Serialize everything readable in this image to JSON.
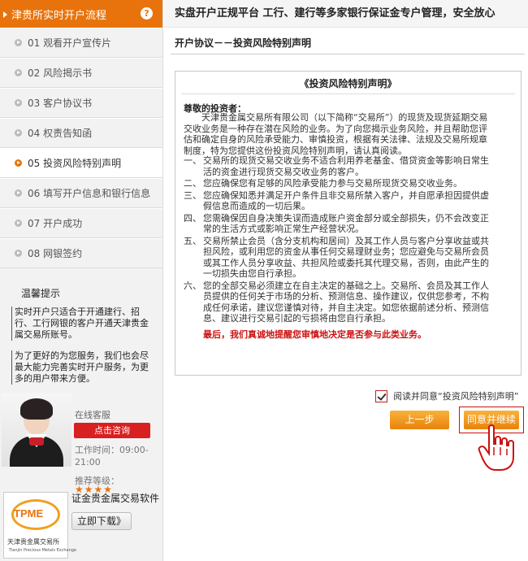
{
  "sidebar": {
    "title": "津贵所实时开户流程",
    "help_glyph": "?",
    "steps": [
      {
        "label": "01  观看开户宣传片"
      },
      {
        "label": "02  风险揭示书"
      },
      {
        "label": "03  客户协议书"
      },
      {
        "label": "04  权责告知函"
      },
      {
        "label": "05  投资风险特别声明",
        "active": true
      },
      {
        "label": "06  填写开户信息和银行信息"
      },
      {
        "label": "07  开户成功"
      },
      {
        "label": "08  网银签约"
      }
    ],
    "tips_title": "温馨提示",
    "tips": [
      "实时开户只适合于开通建行、招行、工行网银的客户开通天津贵金属交易所账号。",
      "为了更好的为您服务，我们也会尽最大能力完善实时开户服务，为更多的用户带来方便。"
    ],
    "service": {
      "title": "在线客服",
      "consult_button": "点击咨询",
      "hours": "工作时间：09:00-21:00"
    },
    "download": {
      "rating_label": "推荐等级：",
      "stars": "★★★★",
      "software_name": "证金贵金属交易软件",
      "button": "立即下载》",
      "logo_text": "TPME",
      "logo_cn": "天津贵金属交易所",
      "logo_en": "Tianjin Precious Metals Exchange"
    }
  },
  "header": {
    "slogan": "实盘开户正规平台  工行、建行等多家银行保证金专户管理，安全放心"
  },
  "main": {
    "section_title": "开户协议－－投资风险特别声明",
    "statement": {
      "title": "《投资风险特别声明》",
      "greeting": "尊敬的投资者：",
      "intro": "天津贵金属交易所有限公司（以下简称“交易所”）的现货及现货延期交易交收业务是一种存在潜在风险的业务。为了向您揭示业务风险，并且帮助您评估和确定自身的风险承受能力、审慎投资，根据有关法律、法规及交易所规章制度，特为您提供这份投资风险特别声明，请认真阅读。",
      "clauses": [
        {
          "num": "一、",
          "text": "交易所的现货交易交收业务不适合利用养老基金、借贷资金等影响日常生活的资金进行现货交易交收业务的客户。"
        },
        {
          "num": "二、",
          "text": "您应确保您有足够的风险承受能力参与交易所现货交易交收业务。"
        },
        {
          "num": "三、",
          "text": "您应确保知悉并满足开户条件且非交易所禁入客户，并自愿承担因提供虚假信息而造成的一切后果。"
        },
        {
          "num": "四、",
          "text": "您需确保因自身决策失误而造成账户资金部分或全部损失，仍不会改变正常的生活方式或影响正常生产经营状况。"
        },
        {
          "num": "五、",
          "text": "交易所禁止会员（含分支机构和居间）及其工作人员与客户分享收益或共担风险，或利用您的资金从事任何交易理财业务；您应避免与交易所会员或其工作人员分享收益、共担风险或委托其代理交易，否则，由此产生的一切损失由您自行承担。"
        },
        {
          "num": "六、",
          "text": "您的全部交易必须建立在自主决定的基础之上。交易所、会员及其工作人员提供的任何关于市场的分析、预测信息、操作建议，仅供您参考，不构成任何承诺，建议您谨慎对待，并自主决定。如您依据前述分析、预测信息、建议进行交易引起的亏损将由您自行承担。"
        }
      ],
      "final_warning": "最后，我们真诚地提醒您审慎地决定是否参与此类业务。"
    },
    "agree_label": "阅读并同意“投资风险特别声明”",
    "agree_checked": true,
    "prev_button": "上一步",
    "next_button": "同意并继续"
  },
  "colors": {
    "accent": "#e8730c",
    "warning_red": "#cc1111",
    "button_orange": "#f0a020"
  }
}
